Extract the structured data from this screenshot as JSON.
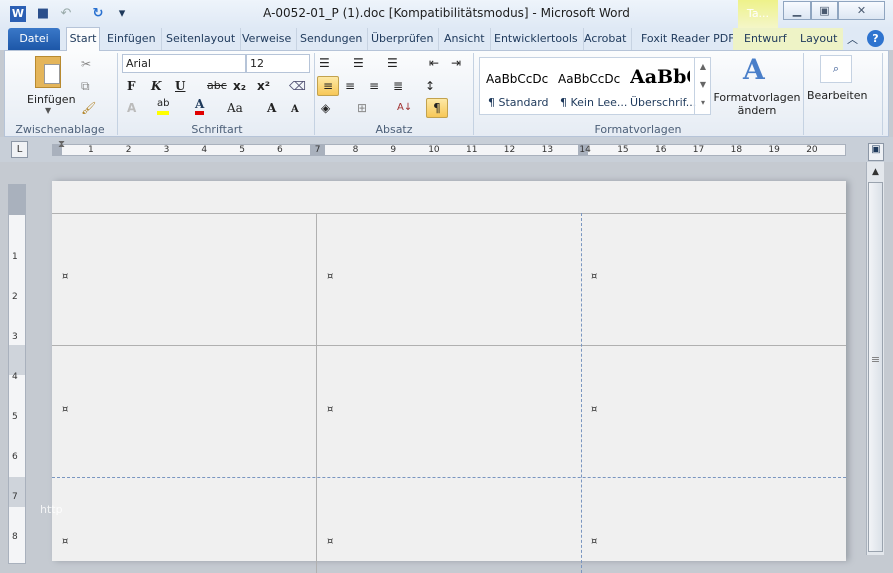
{
  "app": {
    "title": "A-0052-01_P (1).doc [Kompatibilitätsmodus]  -  Microsoft Word",
    "context_tab": "Ta..."
  },
  "quick_access": [
    "word-icon",
    "save-icon",
    "undo-icon",
    "redo-icon",
    "customize-icon"
  ],
  "tabs": [
    {
      "label": "Datei"
    },
    {
      "label": "Start"
    },
    {
      "label": "Einfügen"
    },
    {
      "label": "Seitenlayout"
    },
    {
      "label": "Verweise"
    },
    {
      "label": "Sendungen"
    },
    {
      "label": "Überprüfen"
    },
    {
      "label": "Ansicht"
    },
    {
      "label": "Entwicklertools"
    },
    {
      "label": "Acrobat"
    },
    {
      "label": "Foxit Reader PDF"
    },
    {
      "label": "Entwurf"
    },
    {
      "label": "Layout"
    }
  ],
  "ribbon": {
    "clipboard": {
      "paste_label": "Einfügen",
      "group": "Zwischenablage"
    },
    "font": {
      "name": "Arial",
      "size": "12",
      "group": "Schriftart",
      "bold": "F",
      "italic": "K",
      "underline": "U",
      "strike": "abc",
      "sub": "x₂",
      "sup": "x²",
      "case": "Aa",
      "grow": "A",
      "shrink": "A",
      "highlight_color": "#ffff00",
      "font_color": "#e00000"
    },
    "paragraph": {
      "group": "Absatz",
      "pilcrow": "¶"
    },
    "styles": {
      "group": "Formatvorlagen",
      "items": [
        {
          "preview": "AaBbCcDc",
          "label": "¶ Standard"
        },
        {
          "preview": "AaBbCcDc",
          "label": "¶ Kein Lee..."
        },
        {
          "preview": "AaBbC",
          "label": "Überschrif..."
        }
      ],
      "change_label": "Formatvorlagen ändern"
    },
    "editing": {
      "label": "Bearbeiten"
    }
  },
  "ruler": {
    "ticks": [
      "1",
      "2",
      "3",
      "4",
      "5",
      "6",
      "7",
      "8",
      "9",
      "10",
      "11",
      "12",
      "13",
      "14",
      "15",
      "16",
      "17",
      "18",
      "19",
      "20"
    ],
    "vticks": [
      "1",
      "2",
      "3",
      "4",
      "5",
      "6",
      "7",
      "8"
    ]
  },
  "document": {
    "cell_marker": "¤",
    "watermark": "http"
  }
}
